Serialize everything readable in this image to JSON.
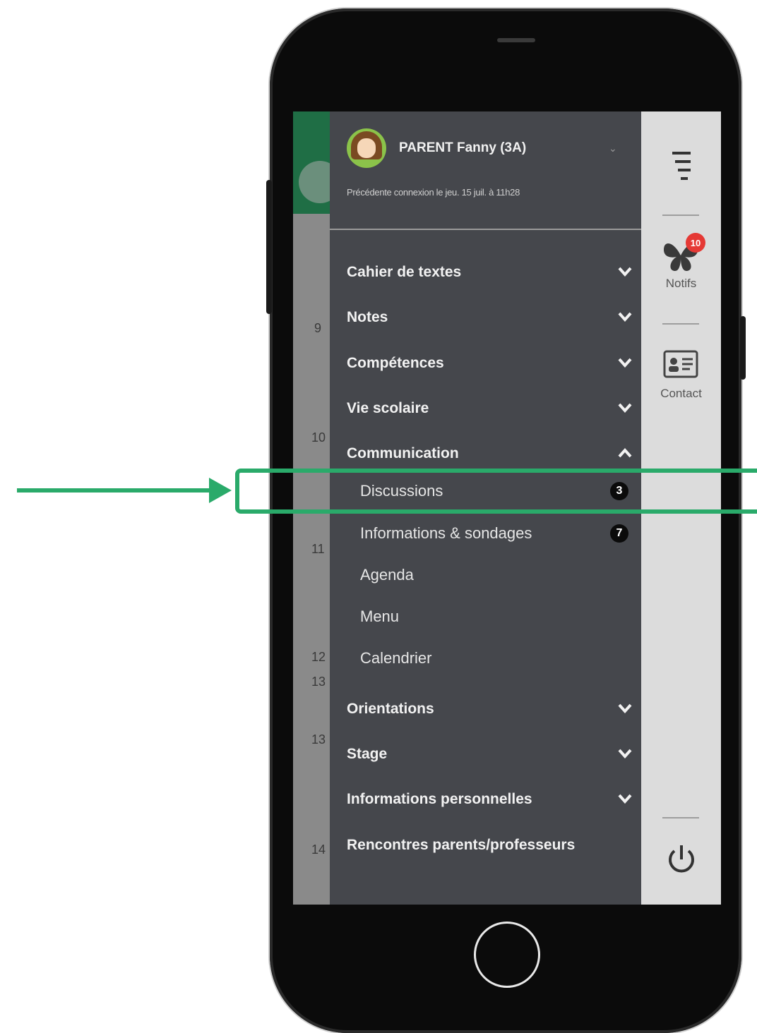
{
  "user": {
    "name": "PARENT Fanny (3A)",
    "last_connection": "Précédente connexion le jeu. 15 juil. à 11h28"
  },
  "menu": {
    "items": [
      {
        "label": "Cahier de textes",
        "expanded": false
      },
      {
        "label": "Notes",
        "expanded": false
      },
      {
        "label": "Compétences",
        "expanded": false
      },
      {
        "label": "Vie scolaire",
        "expanded": false
      },
      {
        "label": "Communication",
        "expanded": true
      }
    ],
    "communication_sub": [
      {
        "label": "Discussions",
        "badge": "3"
      },
      {
        "label": "Informations & sondages",
        "badge": "7"
      },
      {
        "label": "Agenda"
      },
      {
        "label": "Menu"
      },
      {
        "label": "Calendrier"
      }
    ],
    "items_after": [
      {
        "label": "Orientations",
        "expanded": false
      },
      {
        "label": "Stage",
        "expanded": false
      },
      {
        "label": "Informations personnelles",
        "expanded": false
      },
      {
        "label": "Rencontres parents/professeurs"
      }
    ]
  },
  "rail": {
    "notifs_label": "Notifs",
    "notifs_count": "10",
    "contact_label": "Contact"
  },
  "background_numbers": [
    "9",
    "10",
    "11",
    "12",
    "13",
    "13",
    "14"
  ],
  "colors": {
    "menu_bg": "#45474c",
    "rail_bg": "#dcdcdc",
    "accent_green": "#2aaa6a",
    "notif_red": "#e53935"
  }
}
